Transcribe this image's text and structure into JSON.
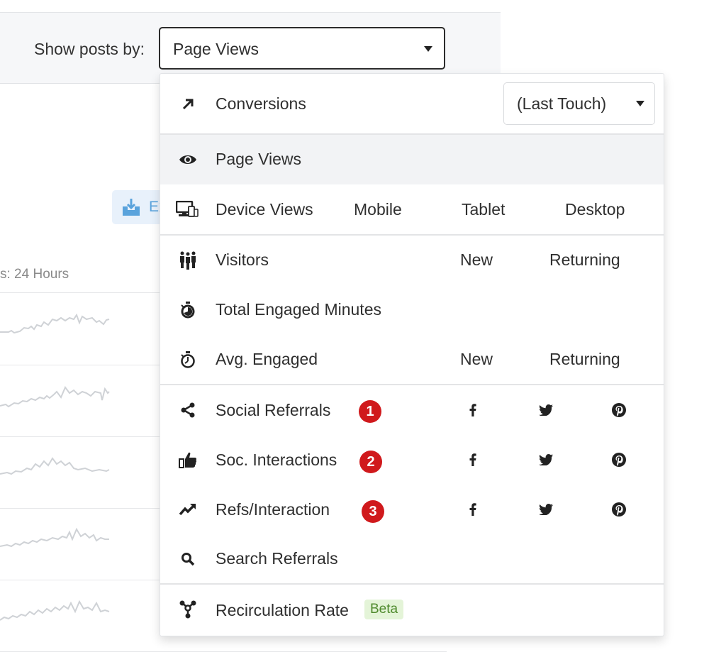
{
  "header": {
    "show_label": "Show posts by:",
    "selected_metric": "Page Views"
  },
  "background": {
    "export_label": "Ex",
    "range_label": "s: 24 Hours"
  },
  "menu": {
    "conversions": {
      "label": "Conversions",
      "icon": "arrow-up-right-icon",
      "attribution": "(Last Touch)"
    },
    "page_views": {
      "label": "Page Views",
      "icon": "eye-icon",
      "selected": true
    },
    "device_views": {
      "label": "Device Views",
      "icon": "devices-icon",
      "options": [
        "Mobile",
        "Tablet",
        "Desktop"
      ]
    },
    "visitors": {
      "label": "Visitors",
      "icon": "people-icon",
      "options": [
        "New",
        "Returning"
      ]
    },
    "total_engaged": {
      "label": "Total Engaged Minutes",
      "icon": "stopwatch-filled-icon"
    },
    "avg_engaged": {
      "label": "Avg. Engaged",
      "icon": "stopwatch-icon",
      "options": [
        "New",
        "Returning"
      ]
    },
    "social_referrals": {
      "label": "Social Referrals",
      "icon": "share-icon",
      "badge": "1",
      "networks": [
        "facebook",
        "twitter",
        "pinterest"
      ]
    },
    "soc_interactions": {
      "label": "Soc. Interactions",
      "icon": "thumbs-up-icon",
      "badge": "2",
      "networks": [
        "facebook",
        "twitter",
        "pinterest"
      ]
    },
    "refs_interaction": {
      "label": "Refs/Interaction",
      "icon": "trending-up-icon",
      "badge": "3",
      "networks": [
        "facebook",
        "twitter",
        "pinterest"
      ]
    },
    "search_referrals": {
      "label": "Search Referrals",
      "icon": "search-icon"
    },
    "recirculation": {
      "label": "Recirculation Rate",
      "icon": "network-icon",
      "tag": "Beta"
    }
  },
  "colors": {
    "badge": "#d0191c",
    "beta_bg": "#e4f4d8",
    "beta_text": "#4f8a2d",
    "export_accent": "#5aa3dc",
    "selected_row": "#f2f3f5"
  }
}
